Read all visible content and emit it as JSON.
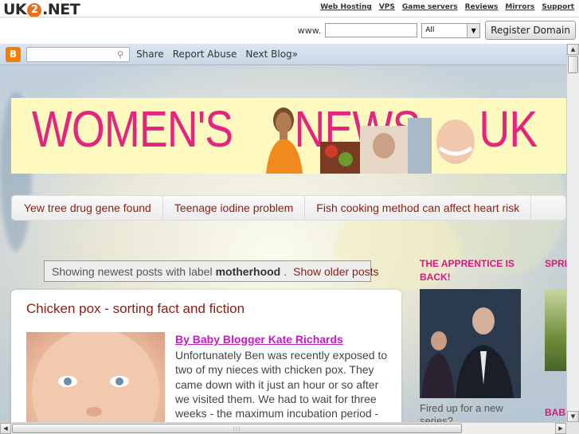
{
  "uk2": {
    "logo_left": "UK",
    "logo_mid": "2",
    "logo_right": ".NET",
    "links": [
      "Web Hosting",
      "VPS",
      "Game servers",
      "Reviews",
      "Mirrors",
      "Support"
    ],
    "www_label": "www.",
    "domain_value": "",
    "tld_selected": "All",
    "register_label": "Register Domain"
  },
  "navbar": {
    "search_value": "",
    "share_label": "Share",
    "report_label": "Report Abuse",
    "next_label": "Next Blog»"
  },
  "header": {
    "title_1": "WOMEN'S",
    "title_2": "NEWS",
    "title_3": "UK"
  },
  "tabs": [
    "Yew tree drug gene found",
    "Teenage iodine problem",
    "Fish cooking method can affect heart risk"
  ],
  "status": {
    "prefix": "Showing newest posts with label",
    "label": "motherhood",
    "suffix": ".",
    "older_link": "Show older posts"
  },
  "post": {
    "title": "Chicken pox - sorting fact and fiction",
    "byline": "By Baby Blogger Kate Richards",
    "body": "Unfortunately Ben was recently exposed to two of my nieces with chicken pox. They came down with it just an hour or so after we visited them. We had to wait for three weeks - the maximum incubation period - to see if"
  },
  "sidebar": {
    "widget_1_title": "THE APPRENTICE IS BACK!",
    "widget_1_caption": "Fired up for a new series?",
    "widget_2_title": "SPRI",
    "widget_3_title": "BABY"
  },
  "colors": {
    "accent": "#8b1d12",
    "sidebar_heading": "#d4197f",
    "header_text": "#e5247f",
    "header_bg": "#fdf9bf",
    "byline": "#c21dc2"
  }
}
